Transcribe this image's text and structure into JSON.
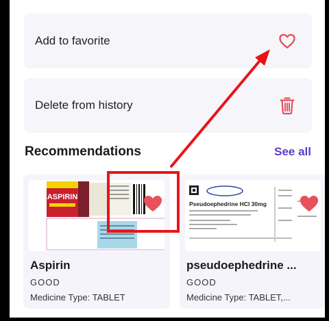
{
  "actions": {
    "favorite_label": "Add to favorite",
    "delete_label": "Delete from history"
  },
  "recommendations": {
    "title": "Recommendations",
    "see_all": "See all",
    "items": [
      {
        "name": "Aspirin",
        "grade": "GOOD",
        "type": "Medicine Type:  TABLET",
        "image_text": "ASPIRIN"
      },
      {
        "name": "pseudoephedrine ...",
        "grade": "GOOD",
        "type": "Medicine Type:  TABLET,...",
        "image_text": "Pseudoephedrine HCl 30mg"
      }
    ]
  },
  "colors": {
    "accent": "#5b3cc4",
    "heart": "#e8505b",
    "trash": "#e8505b",
    "annotation": "#e8141a"
  },
  "icons": {
    "favorite": "heart-outline-icon",
    "delete": "trash-icon",
    "card_favorite": "heart-filled-icon"
  }
}
